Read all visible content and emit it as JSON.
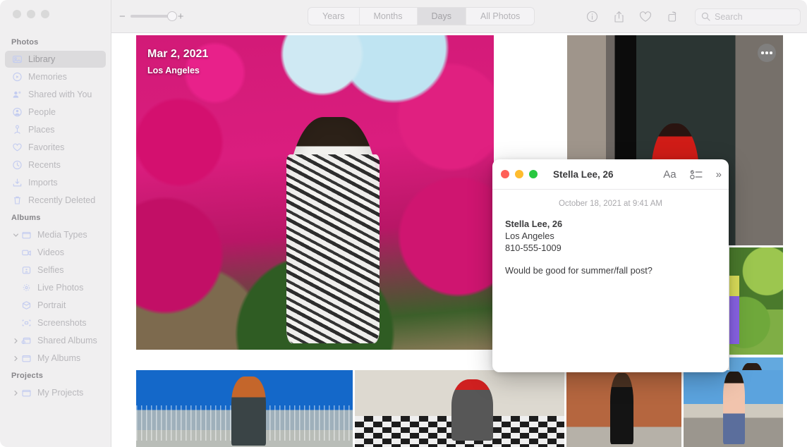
{
  "app": {
    "name": "Photos"
  },
  "window_controls": {
    "close": "close",
    "minimize": "minimize",
    "maximize": "maximize"
  },
  "toolbar": {
    "zoom": {
      "minus": "−",
      "plus": "+",
      "level": 85
    },
    "view_modes": [
      {
        "label": "Years",
        "active": false
      },
      {
        "label": "Months",
        "active": false
      },
      {
        "label": "Days",
        "active": true
      },
      {
        "label": "All Photos",
        "active": false
      }
    ],
    "actions": [
      {
        "name": "info-icon",
        "label": "Info"
      },
      {
        "name": "share-icon",
        "label": "Share"
      },
      {
        "name": "heart-icon",
        "label": "Favorite"
      },
      {
        "name": "rotate-icon",
        "label": "Rotate"
      }
    ],
    "search": {
      "placeholder": "Search",
      "value": ""
    }
  },
  "sidebar": {
    "sections": [
      {
        "header": "Photos",
        "items": [
          {
            "label": "Library",
            "icon": "library-icon",
            "selected": true
          },
          {
            "label": "Memories",
            "icon": "memories-icon",
            "selected": false
          },
          {
            "label": "Shared with You",
            "icon": "shared-with-you-icon",
            "selected": false
          },
          {
            "label": "People",
            "icon": "people-icon",
            "selected": false
          },
          {
            "label": "Places",
            "icon": "places-icon",
            "selected": false
          },
          {
            "label": "Favorites",
            "icon": "heart-icon",
            "selected": false
          },
          {
            "label": "Recents",
            "icon": "clock-icon",
            "selected": false
          },
          {
            "label": "Imports",
            "icon": "import-icon",
            "selected": false
          },
          {
            "label": "Recently Deleted",
            "icon": "trash-icon",
            "selected": false
          }
        ]
      },
      {
        "header": "Albums",
        "items": [
          {
            "label": "Media Types",
            "icon": "folder-icon",
            "twisty": "expanded",
            "selected": false
          },
          {
            "label": "Videos",
            "icon": "video-icon",
            "indent": true,
            "selected": false
          },
          {
            "label": "Selfies",
            "icon": "selfie-icon",
            "indent": true,
            "selected": false
          },
          {
            "label": "Live Photos",
            "icon": "live-photo-icon",
            "indent": true,
            "selected": false
          },
          {
            "label": "Portrait",
            "icon": "portrait-icon",
            "indent": true,
            "selected": false
          },
          {
            "label": "Screenshots",
            "icon": "screenshot-icon",
            "indent": true,
            "selected": false
          },
          {
            "label": "Shared Albums",
            "icon": "shared-folder-icon",
            "twisty": "collapsed",
            "selected": false
          },
          {
            "label": "My Albums",
            "icon": "folder-icon",
            "twisty": "collapsed",
            "selected": false
          }
        ]
      },
      {
        "header": "Projects",
        "items": [
          {
            "label": "My Projects",
            "icon": "folder-icon",
            "twisty": "collapsed",
            "selected": false
          }
        ]
      }
    ]
  },
  "photo_grid": {
    "hero": {
      "date": "Mar 2, 2021",
      "location": "Los Angeles",
      "alt": "woman in black and white patterned dress in front of pink bougainvillea"
    },
    "more_button": "more-options",
    "items": [
      {
        "alt": "man in red hooded garment in dark doorway"
      },
      {
        "alt": "person in yellow top and purple pants in green garden"
      },
      {
        "alt": "woman with long red hair on a bridge walkway"
      },
      {
        "alt": "woman in red bucket hat seated on checkered floor"
      },
      {
        "alt": "woman in black dress against orange brick wall"
      },
      {
        "alt": "woman in pink patterned kimono on a sunny street"
      }
    ]
  },
  "notes_window": {
    "title": "Stella Lee, 26",
    "tools": {
      "format": "Aa",
      "checklist": "checklist-icon",
      "expand": "»"
    },
    "date": "October 18, 2021 at 9:41 AM",
    "lines": [
      {
        "text": "Stella Lee, 26",
        "bold": true
      },
      {
        "text": "Los Angeles",
        "bold": false
      },
      {
        "text": "810-555-1009",
        "bold": false
      },
      {
        "text": "",
        "bold": false
      },
      {
        "text": "Would be good for summer/fall post?",
        "bold": false
      }
    ]
  },
  "colors": {
    "sidebar_bg": "#f0eff0",
    "sidebar_icon": "#c3ccf0",
    "selected_bg": "#dcdbdd",
    "traffic_red": "#ff5f57",
    "traffic_yellow": "#febc2e",
    "traffic_green": "#28c840"
  }
}
